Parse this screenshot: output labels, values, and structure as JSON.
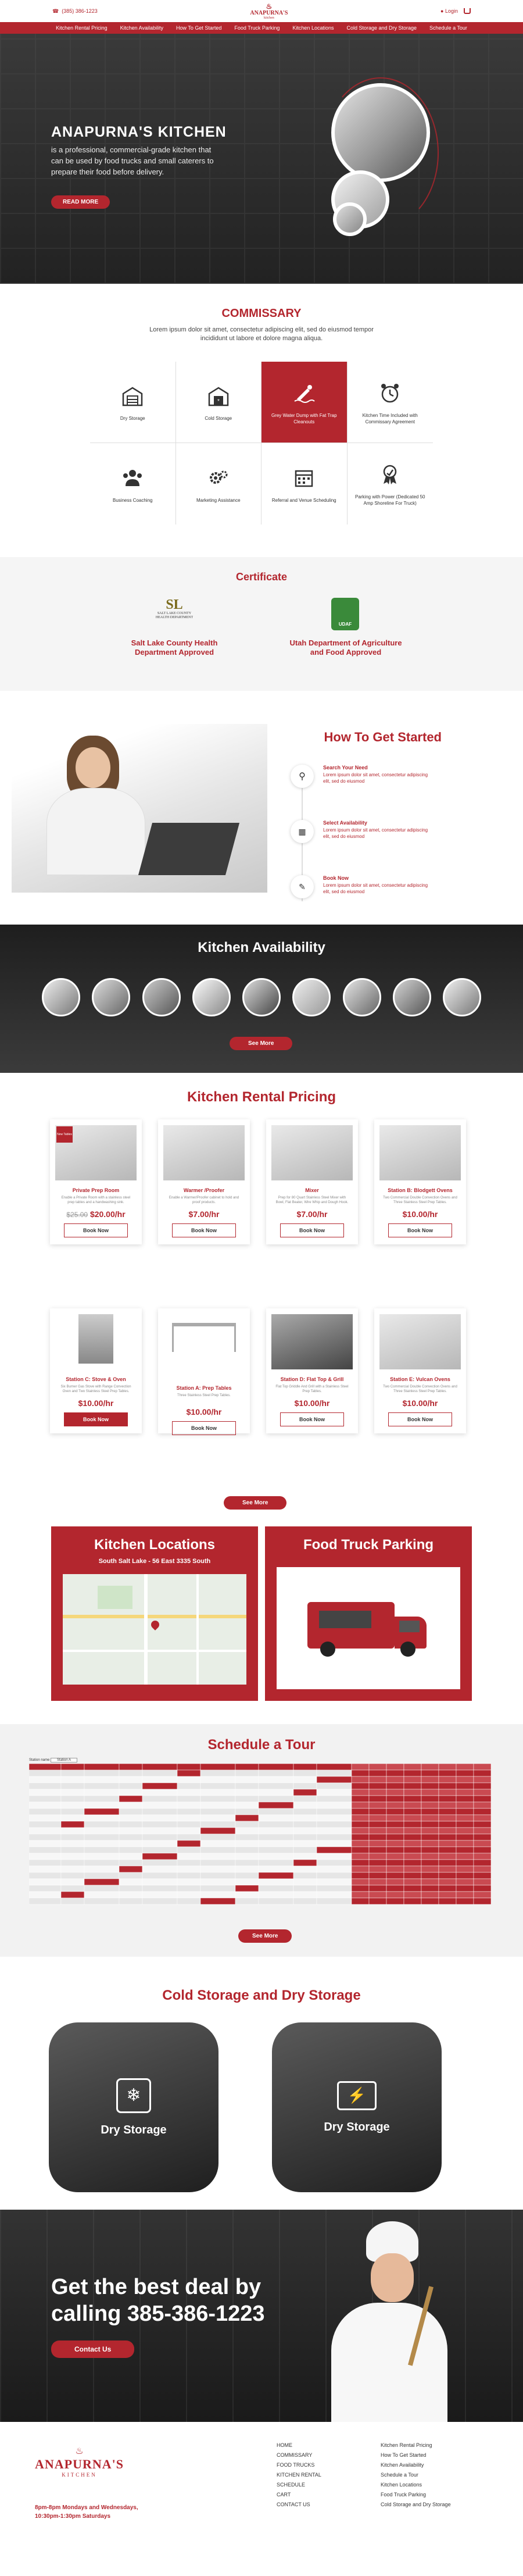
{
  "header": {
    "phone": "(385) 386-1223",
    "logo": "ANAPURNA'S",
    "logo_sub": "kitchen",
    "login": "Login"
  },
  "nav": [
    "Kitchen Rental Pricing",
    "Kitchen Availability",
    "How To Get Started",
    "Food Truck Parking",
    "Kitchen Locations",
    "Cold Storage and Dry Storage",
    "Schedule a Tour"
  ],
  "hero": {
    "title": "ANAPURNA'S KITCHEN",
    "text": "is a professional, commercial-grade kitchen that can be used by food trucks and small caterers to prepare their food before delivery.",
    "button": "READ MORE"
  },
  "commissary": {
    "title": "COMMISSARY",
    "intro": "Lorem ipsum dolor sit amet, consectetur adipiscing elit, sed do eiusmod tempor incididunt ut labore et dolore magna aliqua.",
    "items": [
      "Dry Storage",
      "Cold Storage",
      "Grey Water Dump with Fat Trap Cleanouts",
      "Kitchen Time Included with Commissary Agreement",
      "Business Coaching",
      "Marketing Assistance",
      "Referral and Venue Scheduling",
      "Parking with Power (Dedicated 50 Amp Shoreline For Truck)"
    ]
  },
  "certificate": {
    "title": "Certificate",
    "items": [
      {
        "badge": "SALT LAKE COUNTY HEALTH DEPARTMENT",
        "label": "Salt Lake County Health Department Approved"
      },
      {
        "badge": "UDAF",
        "label": "Utah Department of Agriculture and Food Approved"
      }
    ]
  },
  "started": {
    "title": "How To Get Started",
    "steps": [
      {
        "title": "Search Your Need",
        "text": "Lorem ipsum dolor sit amet, consectetur adipiscing elit, sed do eiusmod"
      },
      {
        "title": "Select Availability",
        "text": "Lorem ipsum dolor sit amet, consectetur adipiscing elit, sed do eiusmod"
      },
      {
        "title": "Book Now",
        "text": "Lorem ipsum dolor sit amet, consectetur adipiscing elit, sed do eiusmod"
      }
    ]
  },
  "availability": {
    "title": "Kitchen Availability",
    "button": "See More"
  },
  "pricing": {
    "title": "Kitchen Rental Pricing",
    "button": "See More",
    "cards": [
      {
        "name": "Private Prep Room",
        "desc": "Enable a Private Room with a stainless steel prep tables and a handwashing sink.",
        "old": "$25.00",
        "price": "$20.00/hr",
        "book": "Book Now",
        "tag": "New Tables"
      },
      {
        "name": "Warmer /Proofer",
        "desc": "Enable a Warmer/Proofer cabinet to hold and proof products.",
        "old": "",
        "price": "$7.00/hr",
        "book": "Book Now",
        "tag": ""
      },
      {
        "name": "Mixer",
        "desc": "Prep for 80 Quart Stainless Steel Mixer with Bowl, Flat Beater, Wire Whip and Dough Hook.",
        "old": "",
        "price": "$7.00/hr",
        "book": "Book Now",
        "tag": ""
      },
      {
        "name": "Station B: Blodgett Ovens",
        "desc": "Two Commercial Double Convection Ovens and Three Stainless Steel Prep Tables.",
        "old": "",
        "price": "$10.00/hr",
        "book": "Book Now",
        "tag": ""
      },
      {
        "name": "Station C: Stove & Oven",
        "desc": "Six Burner Gas Stove with Range Convection Oven and Two Stainless Steel Prep Tables.",
        "old": "",
        "price": "$10.00/hr",
        "book": "Book Now",
        "tag": ""
      },
      {
        "name": "Station A: Prep Tables",
        "desc": "Three Stainless Steel Prep Tables.",
        "old": "",
        "price": "$10.00/hr",
        "book": "Book Now",
        "tag": ""
      },
      {
        "name": "Station D: Flat Top & Grill",
        "desc": "Flat Top Griddle And Grill with a Stainless Steel Prep Tables.",
        "old": "",
        "price": "$10.00/hr",
        "book": "Book Now",
        "tag": ""
      },
      {
        "name": "Station E: Vulcan Ovens",
        "desc": "Two Commercial Double Convection Ovens and Three Stainless Steel Prep Tables.",
        "old": "",
        "price": "$10.00/hr",
        "book": "Book Now",
        "tag": ""
      }
    ]
  },
  "locations": {
    "title": "Kitchen Locations",
    "address": "South Salt Lake - 56 East 3335 South"
  },
  "parking": {
    "title": "Food Truck Parking"
  },
  "tour": {
    "title": "Schedule a Tour",
    "button": "See More",
    "filter_label": "Station name",
    "filter_value": "Station A"
  },
  "storage": {
    "title": "Cold Storage and Dry Storage",
    "cards": [
      "Dry Storage",
      "Dry Storage"
    ]
  },
  "cta": {
    "title": "Get the best deal by calling 385-386-1223",
    "button": "Contact Us"
  },
  "footer": {
    "logo": "ANAPURNA'S",
    "logo_sub": "KITCHEN",
    "hours": "8pm-8pm Mondays and Wednesdays, 10:30pm-1:30pm Saturdays",
    "col1": [
      "HOME",
      "COMMISSARY",
      "FOOD TRUCKS",
      "KITCHEN RENTAL",
      "SCHEDULE",
      "CART",
      "CONTACT US"
    ],
    "col2": [
      "Kitchen Rental Pricing",
      "How To Get Started",
      "Kitchen Availability",
      "Schedule a Tour",
      "Kitchen Locations",
      "Food Truck Parking",
      "Cold Storage and Dry Storage"
    ]
  }
}
